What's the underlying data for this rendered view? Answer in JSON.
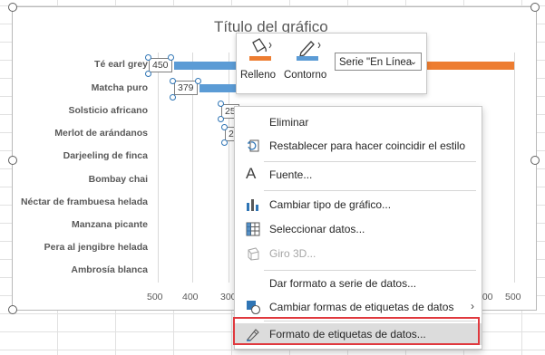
{
  "chart": {
    "title": "Título del gráfico",
    "categories": [
      "Té earl grey",
      "Matcha puro",
      "Solsticio africano",
      "Merlot de arándanos",
      "Darjeeling de finca",
      "Bombay chai",
      "Néctar de frambuesa helada",
      "Manzana picante",
      "Pera al jengibre helada",
      "Ambrosía blanca"
    ],
    "axis_ticks": [
      "500",
      "400",
      "300",
      "400",
      "500"
    ],
    "data_labels": [
      "450",
      "379",
      "25",
      "2"
    ],
    "colors": {
      "series_blue": "#5b9bd5",
      "series_orange": "#ed7d31"
    }
  },
  "chart_data": {
    "type": "bar",
    "title": "Título del gráfico",
    "categories": [
      "Té earl grey",
      "Matcha puro",
      "Solsticio africano",
      "Merlot de arándanos",
      "Darjeeling de finca",
      "Bombay chai",
      "Néctar de frambuesa helada",
      "Manzana picante",
      "Pera al jengibre helada",
      "Ambrosía blanca"
    ],
    "series": [
      {
        "values": [
          450,
          379,
          25,
          2,
          null,
          null,
          null,
          null,
          null,
          null
        ]
      }
    ],
    "xlabel": "",
    "ylabel": ""
  },
  "mini_toolbar": {
    "fill_label": "Relleno",
    "outline_label": "Contorno",
    "series_select": "Serie \"En Línea"
  },
  "context_menu": {
    "items": [
      {
        "label": "Eliminar",
        "icon": "none-icon",
        "disabled": false
      },
      {
        "label": "Restablecer para hacer coincidir el estilo",
        "icon": "reset-style-icon",
        "disabled": false
      },
      {
        "label": "Fuente...",
        "icon": "font-icon",
        "disabled": false
      },
      {
        "label": "Cambiar tipo de gráfico...",
        "icon": "change-chart-type-icon",
        "disabled": false
      },
      {
        "label": "Seleccionar datos...",
        "icon": "select-data-icon",
        "disabled": false
      },
      {
        "label": "Giro 3D...",
        "icon": "rotation-3d-icon",
        "disabled": true
      },
      {
        "label": "Dar formato a serie de datos...",
        "icon": "none-icon",
        "disabled": false
      },
      {
        "label": "Cambiar formas de etiquetas de datos",
        "icon": "label-shapes-icon",
        "disabled": false
      },
      {
        "label": "Formato de etiquetas de datos...",
        "icon": "format-labels-icon",
        "disabled": false
      }
    ]
  }
}
